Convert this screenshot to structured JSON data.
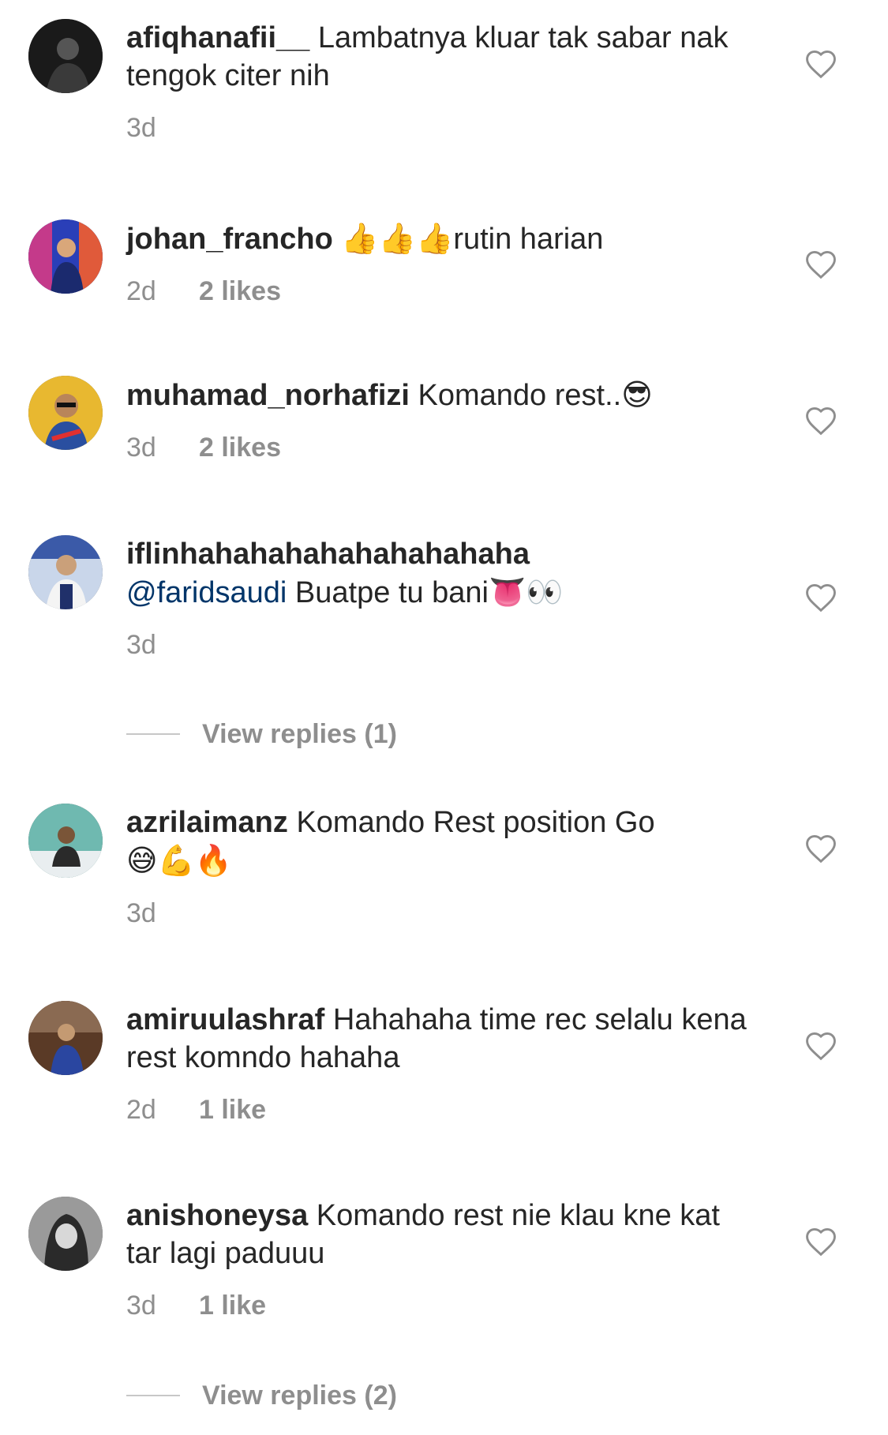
{
  "comments": [
    {
      "username": "afiqhanafii__",
      "text_parts": [
        "Lambatnya kluar tak sabar nak tengok citer nih"
      ],
      "time": "3d",
      "likes": ""
    },
    {
      "username": "johan_francho",
      "emoji": "👍👍👍",
      "text": "rutin harian",
      "time": "2d",
      "likes": "2 likes"
    },
    {
      "username": "muhamad_norhafizi",
      "text": "Komando rest..",
      "emoji": "😎",
      "time": "3d",
      "likes": "2 likes"
    },
    {
      "username": "iflinhahahahahahahahahaha",
      "mention": "@faridsaudi",
      "text": "Buatpe tu bani",
      "emoji": "👅👀",
      "time": "3d",
      "likes": ""
    },
    {
      "username": "azrilaimanz",
      "text": "Komando Rest position Go",
      "emoji": "😅💪🔥",
      "time": "3d",
      "likes": ""
    },
    {
      "username": "amiruulashraf",
      "text": "Hahahaha time rec selalu kena rest komndo hahaha",
      "time": "2d",
      "likes": "1 like"
    },
    {
      "username": "anishoneysa",
      "text": "Komando rest nie klau kne kat tar lagi paduuu",
      "time": "3d",
      "likes": "1 like"
    }
  ],
  "view_replies": [
    "View replies (1)",
    "View replies (2)"
  ],
  "colors": {
    "text": "#262626",
    "secondary": "#8e8e8e",
    "mention": "#003569",
    "divider": "#c7c7c7"
  },
  "icons": {
    "like": "heart-outline-icon"
  }
}
